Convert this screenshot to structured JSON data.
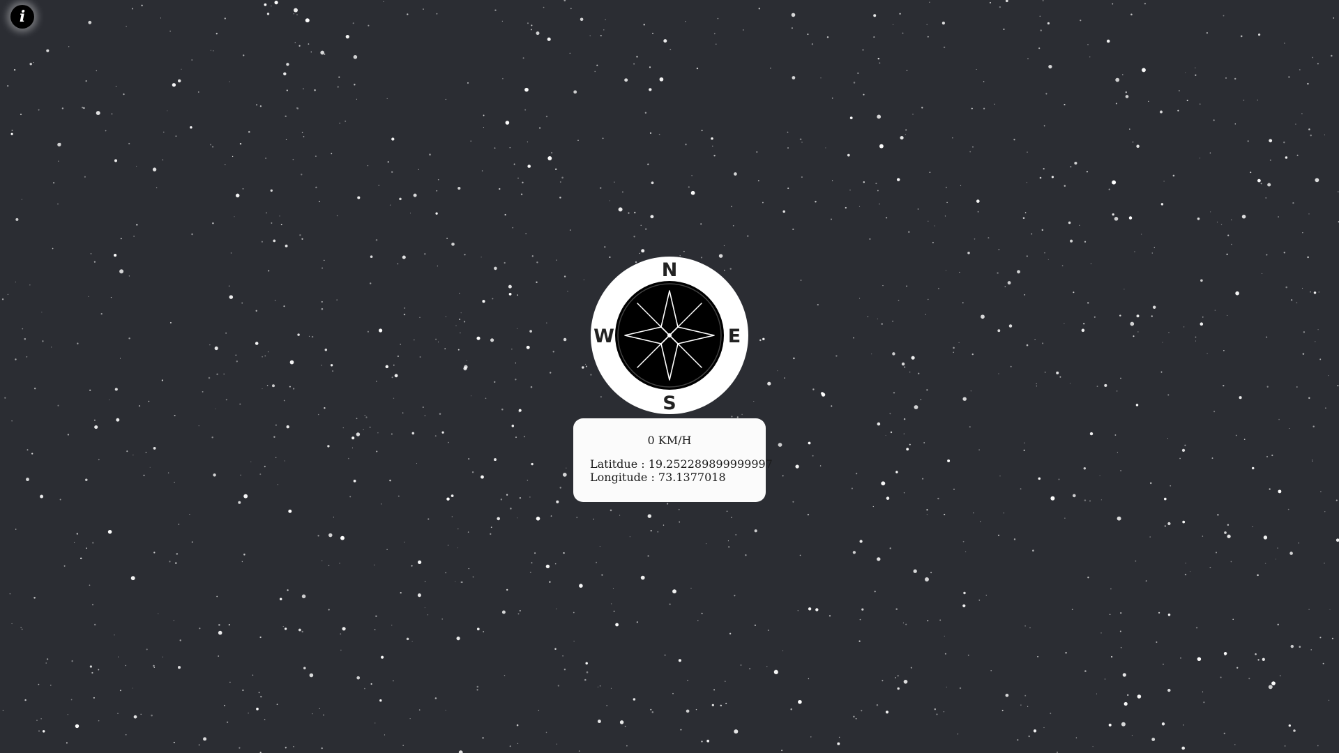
{
  "info_button": {
    "glyph": "i",
    "icon": "info-icon"
  },
  "compass": {
    "icon": "compass-rose-icon",
    "north_label": "N",
    "east_label": "E",
    "south_label": "S",
    "west_label": "W"
  },
  "readout": {
    "speed_text": "0 KM/H",
    "latitude_text": "Latitdue : 19.252289899999997",
    "longitude_text": "Longitude : 73.1377018"
  },
  "colors": {
    "background": "#2b2d33",
    "star": "#ffffff",
    "panel": "#fbfbfb",
    "compass_ring": "#ffffff",
    "compass_face": "#000000"
  }
}
